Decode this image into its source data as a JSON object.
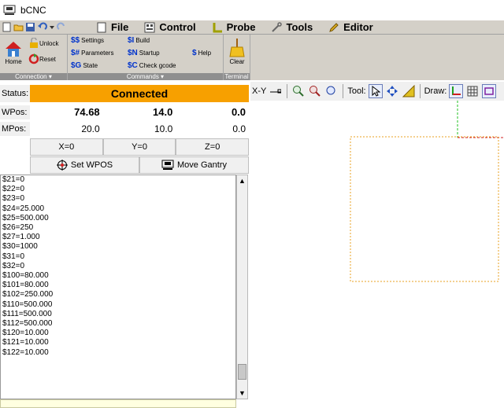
{
  "window": {
    "title": "bCNC"
  },
  "tabs": [
    {
      "label": "File",
      "icon": "file-icon"
    },
    {
      "label": "Control",
      "icon": "control-icon"
    },
    {
      "label": "Probe",
      "icon": "probe-icon"
    },
    {
      "label": "Tools",
      "icon": "tools-icon"
    },
    {
      "label": "Editor",
      "icon": "editor-icon"
    }
  ],
  "ribbon": {
    "connection": {
      "caption": "Connection ▾",
      "home": "Home",
      "unlock": "Unlock",
      "reset": "Reset"
    },
    "commands": {
      "caption": "Commands ▾",
      "settings": "Settings",
      "parameters": "Parameters",
      "state": "State",
      "build": "Build",
      "startup": "Startup",
      "check_gcode": "Check gcode",
      "help": "Help",
      "settings_prefix": "$$",
      "parameters_prefix": "$#",
      "state_prefix": "$G",
      "build_prefix": "$I",
      "startup_prefix": "$N",
      "check_prefix": "$C",
      "help_prefix": "$"
    },
    "terminal": {
      "caption": "Terminal",
      "clear": "Clear"
    }
  },
  "status": {
    "label": "Status:",
    "value": "Connected",
    "color": "#f7a000"
  },
  "wpos": {
    "label": "WPos:",
    "x": "74.68",
    "y": "14.0",
    "z": "0.0"
  },
  "mpos": {
    "label": "MPos:",
    "x": "20.0",
    "y": "10.0",
    "z": "0.0"
  },
  "zero": {
    "x": "X=0",
    "y": "Y=0",
    "z": "Z=0"
  },
  "actions": {
    "set_wpos": "Set WPOS",
    "move_gantry": "Move Gantry"
  },
  "log_lines": [
    "$21=0",
    "$22=0",
    "$23=0",
    "$24=25.000",
    "$25=500.000",
    "$26=250",
    "$27=1.000",
    "$30=1000",
    "$31=0",
    "$32=0",
    "$100=80.000",
    "$101=80.000",
    "$102=250.000",
    "$110=500.000",
    "$111=500.000",
    "$112=500.000",
    "$120=10.000",
    "$121=10.000",
    "$122=10.000"
  ],
  "canvas_toolbar": {
    "view": "X-Y",
    "tool_label": "Tool:",
    "draw_label": "Draw:"
  }
}
